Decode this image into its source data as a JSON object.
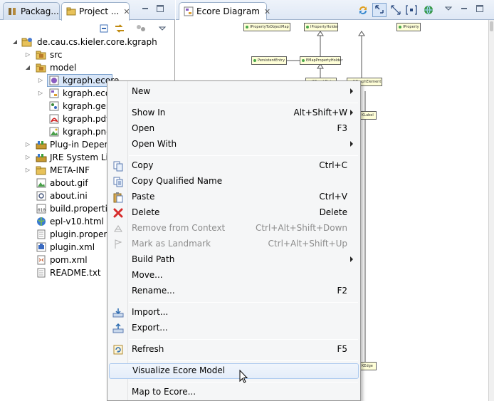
{
  "left_view": {
    "tabs": [
      {
        "label": "Packag...",
        "active": false
      },
      {
        "label": "Project ...",
        "active": true,
        "close": "✕"
      }
    ]
  },
  "tree": {
    "project": "de.cau.cs.kieler.core.kgraph",
    "items": [
      {
        "label": "src",
        "icon": "package-folder-icon"
      },
      {
        "label": "model",
        "icon": "folder-icon"
      },
      {
        "label": "kgraph.ecore",
        "icon": "ecore-file-icon"
      },
      {
        "label": "kgraph.ecore",
        "icon": "ecore-diagram-icon"
      },
      {
        "label": "kgraph.gen",
        "icon": "genmodel-file-icon"
      },
      {
        "label": "kgraph.pdf",
        "icon": "pdf-file-icon"
      },
      {
        "label": "kgraph.png",
        "icon": "image-file-icon"
      },
      {
        "label": "Plug-in Depenc",
        "icon": "library-icon"
      },
      {
        "label": "JRE System Libr",
        "icon": "library-icon"
      },
      {
        "label": "META-INF",
        "icon": "folder-icon"
      },
      {
        "label": "about.gif",
        "icon": "image-file-icon"
      },
      {
        "label": "about.ini",
        "icon": "ini-file-icon"
      },
      {
        "label": "build.properties",
        "icon": "properties-file-icon"
      },
      {
        "label": "epl-v10.html",
        "icon": "html-file-icon"
      },
      {
        "label": "plugin.properti",
        "icon": "text-file-icon"
      },
      {
        "label": "plugin.xml",
        "icon": "plugin-file-icon"
      },
      {
        "label": "pom.xml",
        "icon": "xml-file-icon"
      },
      {
        "label": "README.txt",
        "icon": "text-file-icon"
      }
    ]
  },
  "editor": {
    "tab_label": "Ecore Diagram",
    "tab_close": "✕",
    "diagram_nodes": [
      "IPropertyToObjectMap",
      "IPropertyHolder",
      "IProperty",
      "PersistentEntry",
      "EMapPropertyHolder",
      "KGraphData",
      "KGraphElement",
      "KLabel",
      "KEdge"
    ]
  },
  "context_menu": {
    "items": [
      {
        "label": "New",
        "accel": "",
        "submenu": true,
        "icon": ""
      },
      {
        "label": "Show In",
        "accel": "Alt+Shift+W",
        "submenu": true,
        "icon": ""
      },
      {
        "label": "Open",
        "accel": "F3",
        "submenu": false,
        "icon": ""
      },
      {
        "label": "Open With",
        "accel": "",
        "submenu": true,
        "icon": ""
      },
      {
        "label": "Copy",
        "accel": "Ctrl+C",
        "submenu": false,
        "icon": "copy-icon"
      },
      {
        "label": "Copy Qualified Name",
        "accel": "",
        "submenu": false,
        "icon": "copy-qualified-name-icon"
      },
      {
        "label": "Paste",
        "accel": "Ctrl+V",
        "submenu": false,
        "icon": "paste-icon"
      },
      {
        "label": "Delete",
        "accel": "Delete",
        "submenu": false,
        "icon": "delete-icon"
      },
      {
        "label": "Remove from Context",
        "accel": "Ctrl+Alt+Shift+Down",
        "submenu": false,
        "icon": "remove-context-icon",
        "disabled": true
      },
      {
        "label": "Mark as Landmark",
        "accel": "Ctrl+Alt+Shift+Up",
        "submenu": false,
        "icon": "landmark-icon",
        "disabled": true
      },
      {
        "label": "Build Path",
        "accel": "",
        "submenu": true,
        "icon": ""
      },
      {
        "label": "Move...",
        "accel": "",
        "submenu": false,
        "icon": ""
      },
      {
        "label": "Rename...",
        "accel": "F2",
        "submenu": false,
        "icon": ""
      },
      {
        "label": "Import...",
        "accel": "",
        "submenu": false,
        "icon": "import-icon"
      },
      {
        "label": "Export...",
        "accel": "",
        "submenu": false,
        "icon": "export-icon"
      },
      {
        "label": "Refresh",
        "accel": "F5",
        "submenu": false,
        "icon": "refresh-icon"
      },
      {
        "label": "Visualize Ecore Model",
        "accel": "",
        "submenu": false,
        "icon": "",
        "hover": true
      },
      {
        "label": "Map to Ecore...",
        "accel": "",
        "submenu": false,
        "icon": ""
      }
    ]
  },
  "colors": {
    "selection": "#d8e6f8",
    "menu_hover_border": "#aecbef",
    "delete_red": "#d62b2b",
    "node_fill": "#ffffd8"
  }
}
